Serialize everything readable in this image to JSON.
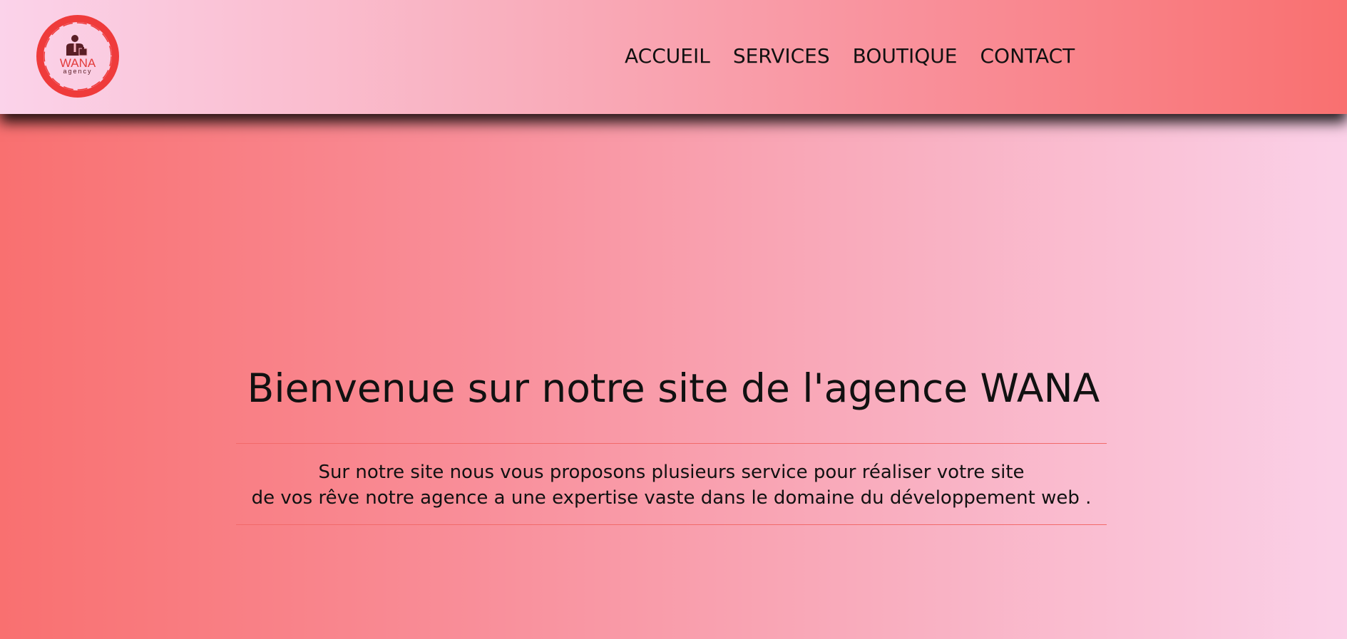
{
  "header": {
    "logo": {
      "icon": "businessman-icon",
      "wordmark": "WANA",
      "subtext": "agency",
      "ring_color": "#ef3b3b"
    },
    "nav": [
      {
        "label": "ACCUEIL"
      },
      {
        "label": "SERVICES"
      },
      {
        "label": "BOUTIQUE"
      },
      {
        "label": "CONTACT"
      }
    ]
  },
  "hero": {
    "title": "Bienvenue sur notre site de l'agence WANA",
    "text_line1": "Sur notre site nous vous proposons plusieurs service pour réaliser votre site",
    "text_line2": "de vos rêve notre agence a une expertise vaste dans le domaine du développement web ."
  },
  "colors": {
    "accent": "#f97070",
    "pink_light": "#fbd3ea",
    "divider": "#f26a6a"
  }
}
